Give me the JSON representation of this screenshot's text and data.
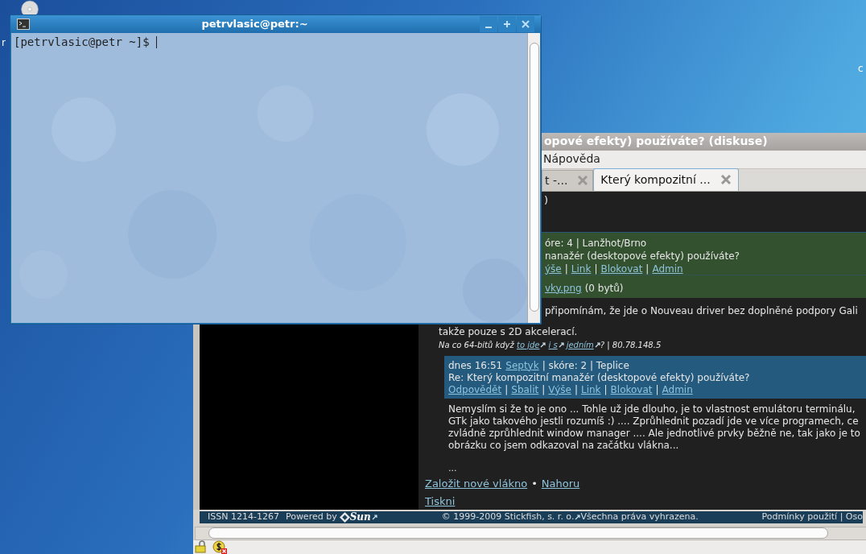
{
  "desktop": {
    "icon_labels": [
      "r",
      "c"
    ]
  },
  "terminal": {
    "title": "petrvlasic@petr:~",
    "prompt": "[petrvlasic@petr ~]$"
  },
  "browser": {
    "title": "opové efekty) používáte? (diskuse)",
    "menu": [
      "Nápověda"
    ],
    "tabs": [
      {
        "label": "t -...",
        "selected": false
      },
      {
        "label": "Který kompozitní ...",
        "selected": true
      }
    ],
    "partial_line": ")",
    "comment_1": {
      "header": "óre: 4 | Lanžhot/Brno",
      "subject": "nanažér (desktopové efekty) používáte?",
      "links": [
        "ýše",
        "Link",
        "Blokovat",
        "Admin"
      ],
      "link_separator": "|",
      "attachment_link": "vky.png",
      "attachment_size": "(0 bytů)"
    },
    "body_1": [
      "připomínám, že jde o Nouveau driver bez doplněné podpory Gali",
      "takže pouze s 2D akcelerací."
    ],
    "signature": [
      {
        "kind": "text",
        "text": "Na co 64-bitů když "
      },
      {
        "kind": "link",
        "text": "to jde",
        "external": true
      },
      {
        "kind": "link",
        "text": "i s",
        "external": true
      },
      {
        "kind": "link",
        "text": "jedním",
        "external": true
      },
      {
        "kind": "text",
        "text": "? | 80.78.148.5"
      }
    ],
    "comment_2": {
      "time": "dnes 16:51",
      "author": "Septyk",
      "meta": "| skóre: 2 | Teplice",
      "subject": "Re: Který kompozitní manažér (desktopové efekty) používáte?",
      "links": [
        "Odpovědět",
        "Sbalit",
        "Výše",
        "Link",
        "Blokovat",
        "Admin"
      ],
      "link_separator": "|",
      "body": [
        "Nemyslím si že to je ono ... Tohle už jde dlouho, je to vlastnost emulátoru terminálu,",
        "GTk jako takového jestli rozumíš :) .... Zprůhlednit pozadí jde ve více programech, ce",
        "zvládně zprůhlednit window manager .... Ale jednotlivé prvky běžně ne, tak jako je to",
        "obrázku co jsem odkazoval na začátku vlákna..."
      ]
    },
    "ellipsis": "...",
    "thread_links": [
      "Založit nové vlákno",
      "Nahoru"
    ],
    "thread_separator": "•",
    "print_link": "Tiskni",
    "footer": {
      "issn": "ISSN 1214-1267",
      "powered": "Powered by",
      "brand": "Sun",
      "copyright": "© 1999-2009 Stickfish, s. r. o.",
      "rights": "Všechna práva vyhrazena.",
      "terms": "Podmínky použití | Oso"
    }
  }
}
